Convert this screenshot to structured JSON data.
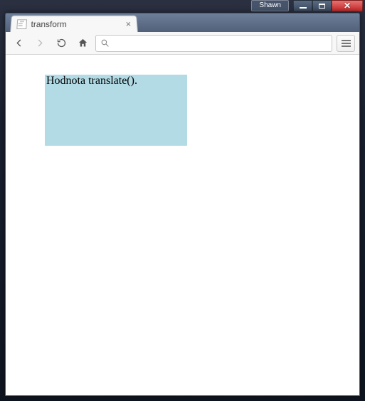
{
  "os": {
    "user_badge": "Shawn"
  },
  "browser": {
    "tab": {
      "title": "transform"
    },
    "omnibox": {
      "value": "",
      "placeholder": ""
    }
  },
  "page": {
    "box_text": "Hodnota translate()."
  }
}
